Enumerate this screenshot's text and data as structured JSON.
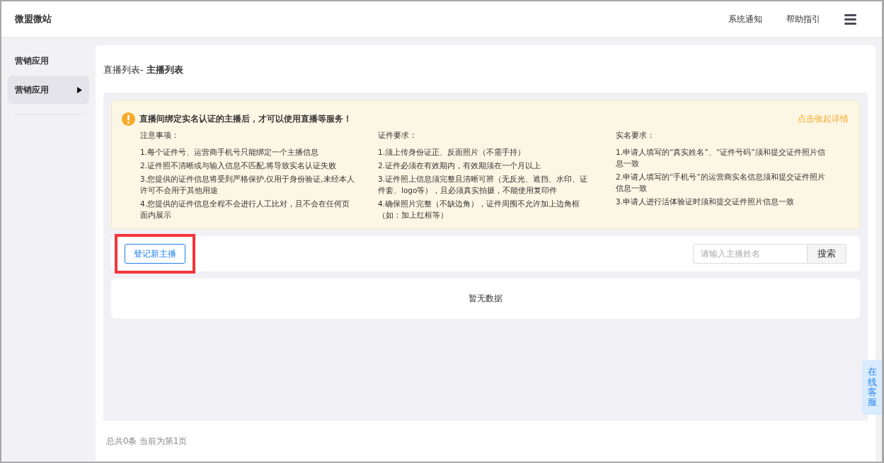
{
  "header": {
    "brand": "微盟微站",
    "links": [
      "系统通知",
      "帮助指引"
    ]
  },
  "sidebar": {
    "heading": "营销应用",
    "items": [
      {
        "label": "营销应用",
        "selected": true
      }
    ]
  },
  "breadcrumb": {
    "parent": "直播列表-",
    "current": "主播列表"
  },
  "notice": {
    "title": "直播间绑定实名认证的主播后，才可以使用直播等服务！",
    "toggle": "点击收起详情",
    "columns": [
      {
        "heading": "注意事项：",
        "items": [
          "1.每个证件号、运营商手机号只能绑定一个主播信息",
          "2.证件照不清晰或与输入信息不匹配,将导致实名认证失败",
          "3.您提供的证件信息将受到严格保护,仅用于身份验证,未经本人许可不会用于其他用途",
          "4.您提供的证件信息全程不会进行人工比对，且不会在任何页面内展示"
        ]
      },
      {
        "heading": "证件要求：",
        "items": [
          "1.须上传身份证正、反面照片（不需手持）",
          "2.证件必须在有效期内，有效期须在一个月以上",
          "3.证件照上信息须完整且清晰可辨（无反光、遮挡、水印、证件套、logo等），且必须真实拍摄，不能使用复印件",
          "4.确保照片完整（不缺边角），证件周围不允许加上边角框（如：加上红框等）"
        ]
      },
      {
        "heading": "实名要求：",
        "items": [
          "1.申请人填写的“真实姓名”、“证件号码”须和提交证件照片信息一致",
          "2.申请人填写的“手机号”的运营商实名信息须和提交证件照片信息一致",
          "3.申请人进行活体验证时须和提交证件照片信息一致"
        ]
      }
    ]
  },
  "toolbar": {
    "add_button": "登记新主播",
    "highlighted": true,
    "search": {
      "placeholder": "请输入主播姓名",
      "button": "搜索"
    }
  },
  "table": {
    "empty": "暂无数据"
  },
  "footer": {
    "summary": "总共0条 当前为第1页"
  },
  "service_tab": "在线客服"
}
